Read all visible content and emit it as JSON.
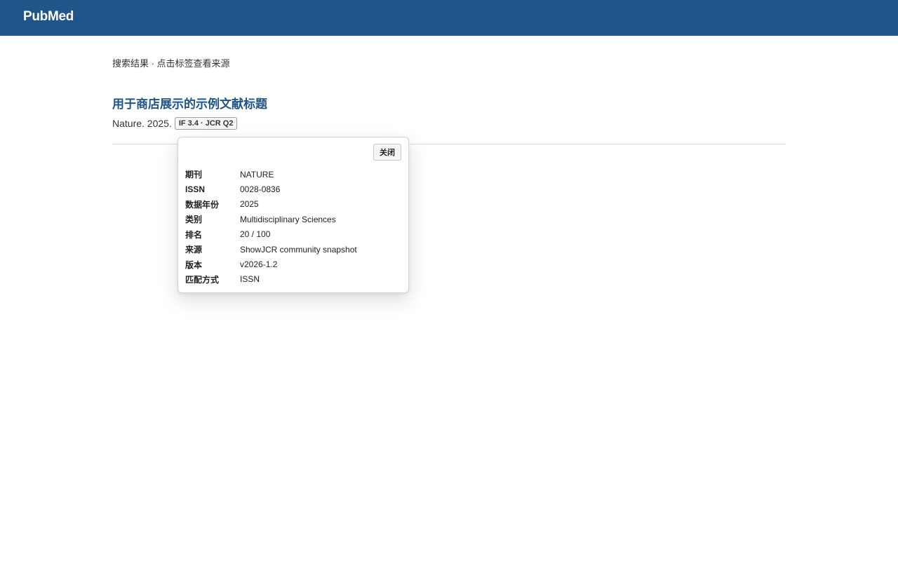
{
  "header": {
    "logo": "PubMed"
  },
  "results": {
    "hint": "搜索结果 · 点击标签查看来源",
    "article": {
      "title": "用于商店展示的示例文献标题",
      "citation": "Nature. 2025.",
      "badge": "IF 3.4 · JCR Q2"
    }
  },
  "popover": {
    "close_label": "关闭",
    "rows": [
      {
        "key": "期刊",
        "value": "NATURE"
      },
      {
        "key": "ISSN",
        "value": "0028-0836"
      },
      {
        "key": "数据年份",
        "value": "2025"
      },
      {
        "key": "类别",
        "value": "Multidisciplinary Sciences"
      },
      {
        "key": "排名",
        "value": "20 / 100"
      },
      {
        "key": "来源",
        "value": "ShowJCR community snapshot"
      },
      {
        "key": "版本",
        "value": "v2026-1.2"
      },
      {
        "key": "匹配方式",
        "value": "ISSN"
      }
    ]
  },
  "colors": {
    "header_bg": "#20558a",
    "title_link": "#20558a"
  }
}
